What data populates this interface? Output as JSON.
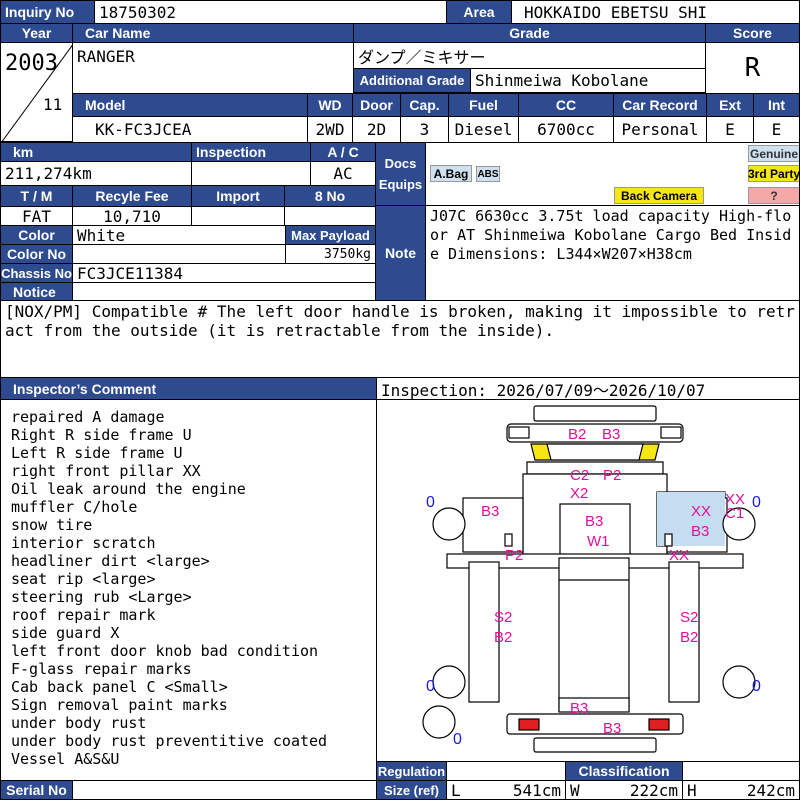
{
  "labels": {
    "inquiry_no": "Inquiry No",
    "area": "Area",
    "year": "Year",
    "car_name": "Car Name",
    "grade": "Grade",
    "score": "Score",
    "additional_grade": "Additional Grade",
    "model": "Model",
    "wd": "WD",
    "door": "Door",
    "cap": "Cap.",
    "fuel": "Fuel",
    "cc": "CC",
    "car_record": "Car Record",
    "ext": "Ext",
    "int": "Int",
    "km": "km",
    "inspection": "Inspection",
    "ac": "A / C",
    "docs": "Docs",
    "equips": "Equips",
    "tm": "T / M",
    "recycle_fee": "Recyle Fee",
    "import": "Import",
    "8no": "8 No",
    "color": "Color",
    "max_payload": "Max Payload",
    "color_no": "Color No",
    "note": "Note",
    "chassis_no": "Chassis No",
    "notice": "Notice",
    "inspectors_comment": "Inspector’s Comment",
    "regulation": "Regulation",
    "size_ref": "Size (ref)",
    "classification": "Classification",
    "serial_no": "Serial No",
    "l": "L",
    "w": "W",
    "h": "H"
  },
  "vehicle": {
    "inquiry_no": "18750302",
    "area": "HOKKAIDO EBETSU SHI",
    "year": "2003",
    "month": "11",
    "car_name": "RANGER",
    "grade": "ダンプ／ミキサー",
    "additional_grade": "Shinmeiwa Kobolane",
    "score": "R",
    "model": "KK-FC3JCEA",
    "wd": "2WD",
    "door": "2D",
    "cap": "3",
    "fuel": "Diesel",
    "cc": "6700cc",
    "car_record": "Personal",
    "ext": "E",
    "int": "E",
    "km": "211,274km",
    "inspection": "",
    "ac": "AC",
    "tm": "FAT",
    "recycle_fee": "10,710",
    "import": "",
    "eight_no": "",
    "color": "White",
    "max_payload": "3750kg",
    "color_no": "",
    "chassis_no": "FC3JCE11384",
    "note": "J07C 6630cc 3.75t load capacity High-floor AT Shinmeiwa Kobolane Cargo Bed Inside Dimensions: L344×W207×H38cm",
    "notice": "[NOX/PM] Compatible # The left door handle is broken, making it impossible to retract from the outside (it is retractable from the inside).",
    "regulation": "",
    "classification": "",
    "serial_no": "",
    "size_l": "541cm",
    "size_w": "222cm",
    "size_h": "242cm"
  },
  "equips": {
    "abag": "A.Bag",
    "abs": "ABS",
    "back_camera": "Back Camera",
    "genuine": "Genuine",
    "third_party": "3rd Party",
    "unknown": "?"
  },
  "inspection_period": "Inspection: 2026/07/09〜2026/10/07",
  "comments": [
    "repaired A damage",
    "Right R side frame U",
    "Left R side frame U",
    "right front pillar XX",
    "Oil leak around the engine",
    "muffler C/hole",
    "snow tire",
    "interior scratch",
    "headliner dirt <large>",
    "seat rip <large>",
    "steering rub <Large>",
    "roof repair mark",
    "side guard X",
    "left front door knob bad condition",
    "F-glass repair marks",
    "Cab back panel C <Small>",
    "Sign removal paint marks",
    "under body rust",
    "under body rust preventitive coated",
    "Vessel A&S&U"
  ],
  "diagram_marks": {
    "b2": "B2",
    "b3": "B3",
    "c2": "C2",
    "p2": "P2",
    "x2": "X2",
    "w1": "W1",
    "xx": "XX",
    "c1": "C1",
    "s2": "S2",
    "zero": "0"
  },
  "colors": {
    "header": "#2e4b8f",
    "mark": "#e0109a",
    "zero": "#1a1adf",
    "glass": "#f5e614",
    "damage_area": "#c6dcf0"
  }
}
